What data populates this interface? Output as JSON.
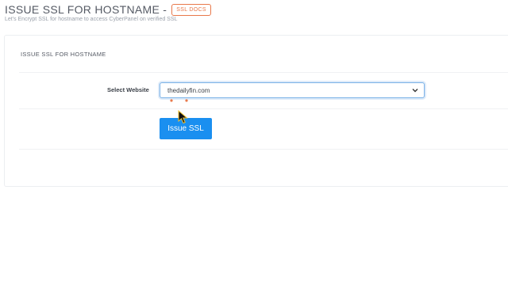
{
  "header": {
    "title": "ISSUE SSL FOR HOSTNAME -",
    "docs_badge": "SSL DOCS",
    "subtitle": "Let's Encrypt SSL for hostname to access CyberPanel on verified SSL"
  },
  "panel": {
    "heading": "ISSUE SSL FOR HOSTNAME",
    "select_label": "Select Website",
    "select_value": "thedailyfin.com",
    "button_label": "Issue SSL"
  },
  "colors": {
    "accent": "#1a8ff0",
    "badge": "#e8784a",
    "focus_border": "#7ab1e6"
  },
  "icons": {
    "select_arrow": "chevron-down-icon",
    "pointer": "mouse-cursor-icon"
  }
}
